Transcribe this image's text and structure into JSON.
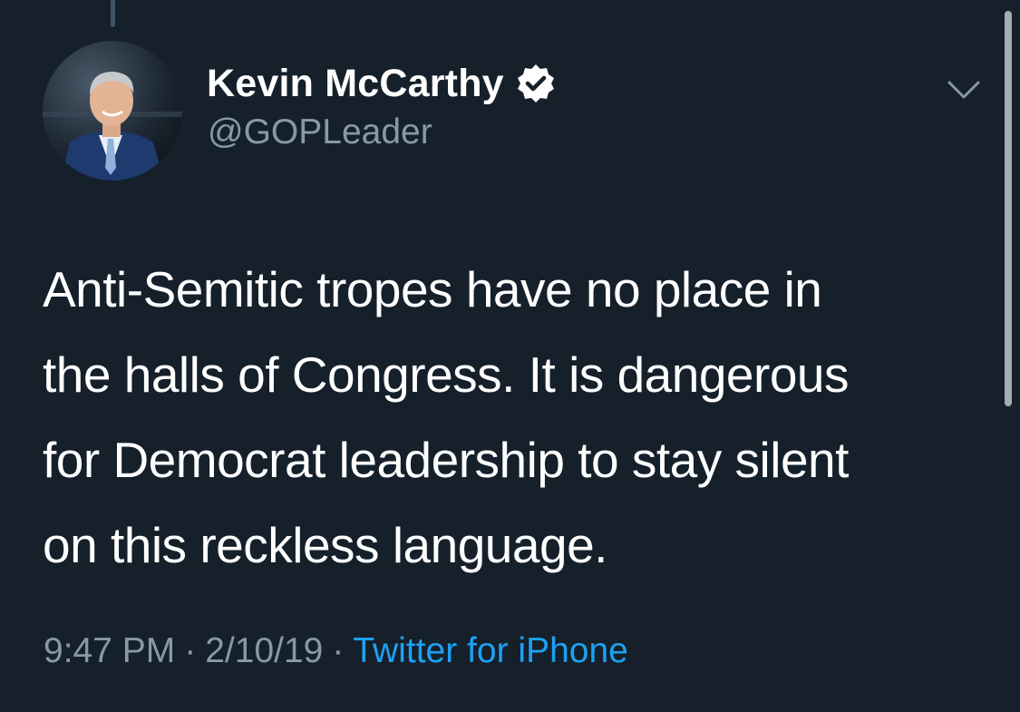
{
  "author": {
    "display_name": "Kevin McCarthy",
    "handle": "@GOPLeader",
    "verified": true,
    "avatar_icon": "profile-photo-avatar"
  },
  "tweet": {
    "lines": [
      "Anti-Semitic tropes have no place in",
      "the halls of Congress. It is dangerous",
      "for Democrat leadership to stay silent",
      "on this reckless language."
    ]
  },
  "meta": {
    "time": "9:47 PM",
    "separator": "·",
    "date": "2/10/19",
    "source": "Twitter for iPhone"
  },
  "icons": {
    "verified": "verified-badge-icon",
    "menu": "chevron-down-icon"
  },
  "colors": {
    "background": "#15202b",
    "primary_text": "#ffffff",
    "secondary_text": "#8899a6",
    "link": "#1da1f2"
  }
}
